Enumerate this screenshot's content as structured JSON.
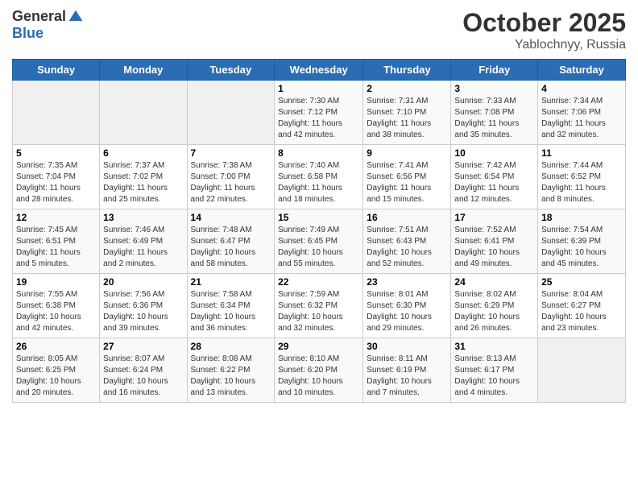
{
  "header": {
    "logo_general": "General",
    "logo_blue": "Blue",
    "month": "October 2025",
    "location": "Yablochnyy, Russia"
  },
  "weekdays": [
    "Sunday",
    "Monday",
    "Tuesday",
    "Wednesday",
    "Thursday",
    "Friday",
    "Saturday"
  ],
  "weeks": [
    [
      {
        "day": "",
        "info": ""
      },
      {
        "day": "",
        "info": ""
      },
      {
        "day": "",
        "info": ""
      },
      {
        "day": "1",
        "info": "Sunrise: 7:30 AM\nSunset: 7:12 PM\nDaylight: 11 hours\nand 42 minutes."
      },
      {
        "day": "2",
        "info": "Sunrise: 7:31 AM\nSunset: 7:10 PM\nDaylight: 11 hours\nand 38 minutes."
      },
      {
        "day": "3",
        "info": "Sunrise: 7:33 AM\nSunset: 7:08 PM\nDaylight: 11 hours\nand 35 minutes."
      },
      {
        "day": "4",
        "info": "Sunrise: 7:34 AM\nSunset: 7:06 PM\nDaylight: 11 hours\nand 32 minutes."
      }
    ],
    [
      {
        "day": "5",
        "info": "Sunrise: 7:35 AM\nSunset: 7:04 PM\nDaylight: 11 hours\nand 28 minutes."
      },
      {
        "day": "6",
        "info": "Sunrise: 7:37 AM\nSunset: 7:02 PM\nDaylight: 11 hours\nand 25 minutes."
      },
      {
        "day": "7",
        "info": "Sunrise: 7:38 AM\nSunset: 7:00 PM\nDaylight: 11 hours\nand 22 minutes."
      },
      {
        "day": "8",
        "info": "Sunrise: 7:40 AM\nSunset: 6:58 PM\nDaylight: 11 hours\nand 18 minutes."
      },
      {
        "day": "9",
        "info": "Sunrise: 7:41 AM\nSunset: 6:56 PM\nDaylight: 11 hours\nand 15 minutes."
      },
      {
        "day": "10",
        "info": "Sunrise: 7:42 AM\nSunset: 6:54 PM\nDaylight: 11 hours\nand 12 minutes."
      },
      {
        "day": "11",
        "info": "Sunrise: 7:44 AM\nSunset: 6:52 PM\nDaylight: 11 hours\nand 8 minutes."
      }
    ],
    [
      {
        "day": "12",
        "info": "Sunrise: 7:45 AM\nSunset: 6:51 PM\nDaylight: 11 hours\nand 5 minutes."
      },
      {
        "day": "13",
        "info": "Sunrise: 7:46 AM\nSunset: 6:49 PM\nDaylight: 11 hours\nand 2 minutes."
      },
      {
        "day": "14",
        "info": "Sunrise: 7:48 AM\nSunset: 6:47 PM\nDaylight: 10 hours\nand 58 minutes."
      },
      {
        "day": "15",
        "info": "Sunrise: 7:49 AM\nSunset: 6:45 PM\nDaylight: 10 hours\nand 55 minutes."
      },
      {
        "day": "16",
        "info": "Sunrise: 7:51 AM\nSunset: 6:43 PM\nDaylight: 10 hours\nand 52 minutes."
      },
      {
        "day": "17",
        "info": "Sunrise: 7:52 AM\nSunset: 6:41 PM\nDaylight: 10 hours\nand 49 minutes."
      },
      {
        "day": "18",
        "info": "Sunrise: 7:54 AM\nSunset: 6:39 PM\nDaylight: 10 hours\nand 45 minutes."
      }
    ],
    [
      {
        "day": "19",
        "info": "Sunrise: 7:55 AM\nSunset: 6:38 PM\nDaylight: 10 hours\nand 42 minutes."
      },
      {
        "day": "20",
        "info": "Sunrise: 7:56 AM\nSunset: 6:36 PM\nDaylight: 10 hours\nand 39 minutes."
      },
      {
        "day": "21",
        "info": "Sunrise: 7:58 AM\nSunset: 6:34 PM\nDaylight: 10 hours\nand 36 minutes."
      },
      {
        "day": "22",
        "info": "Sunrise: 7:59 AM\nSunset: 6:32 PM\nDaylight: 10 hours\nand 32 minutes."
      },
      {
        "day": "23",
        "info": "Sunrise: 8:01 AM\nSunset: 6:30 PM\nDaylight: 10 hours\nand 29 minutes."
      },
      {
        "day": "24",
        "info": "Sunrise: 8:02 AM\nSunset: 6:29 PM\nDaylight: 10 hours\nand 26 minutes."
      },
      {
        "day": "25",
        "info": "Sunrise: 8:04 AM\nSunset: 6:27 PM\nDaylight: 10 hours\nand 23 minutes."
      }
    ],
    [
      {
        "day": "26",
        "info": "Sunrise: 8:05 AM\nSunset: 6:25 PM\nDaylight: 10 hours\nand 20 minutes."
      },
      {
        "day": "27",
        "info": "Sunrise: 8:07 AM\nSunset: 6:24 PM\nDaylight: 10 hours\nand 16 minutes."
      },
      {
        "day": "28",
        "info": "Sunrise: 8:08 AM\nSunset: 6:22 PM\nDaylight: 10 hours\nand 13 minutes."
      },
      {
        "day": "29",
        "info": "Sunrise: 8:10 AM\nSunset: 6:20 PM\nDaylight: 10 hours\nand 10 minutes."
      },
      {
        "day": "30",
        "info": "Sunrise: 8:11 AM\nSunset: 6:19 PM\nDaylight: 10 hours\nand 7 minutes."
      },
      {
        "day": "31",
        "info": "Sunrise: 8:13 AM\nSunset: 6:17 PM\nDaylight: 10 hours\nand 4 minutes."
      },
      {
        "day": "",
        "info": ""
      }
    ]
  ]
}
